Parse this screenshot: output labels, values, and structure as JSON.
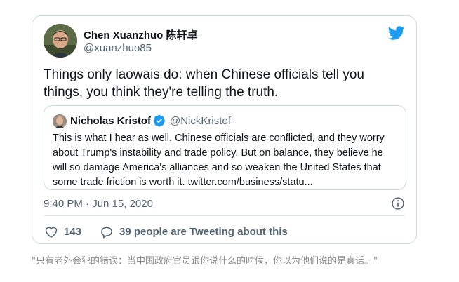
{
  "tweet": {
    "author_name": "Chen Xuanzhuo 陈轩卓",
    "author_handle": "@xuanzhuo85",
    "text": "Things only laowais do: when Chinese officials tell you things, you think they're telling the truth.",
    "timestamp": "9:40 PM · Jun 15, 2020",
    "likes": "143",
    "reply_text": "39 people are Tweeting about this"
  },
  "quoted_tweet": {
    "author_name": "Nicholas Kristof",
    "author_handle": "@NickKristof",
    "verified": true,
    "text": "This is what I hear as well. Chinese officials are conflicted, and they worry about Trump's instability and trade policy. But on balance, they believe he will so damage America's alliances and so weaken the United States that some trade friction is worth it. twitter.com/business/statu..."
  },
  "caption": "\"只有老外会犯的错误：当中国政府官员跟你说什么的时候，你以为他们说的是真话。\"",
  "colors": {
    "twitter_blue": "#1d9bf0",
    "text_primary": "#0f1419",
    "text_secondary": "#536471",
    "border": "#cfd9de"
  },
  "icons": [
    "twitter-bird-icon",
    "verified-badge-icon",
    "info-icon",
    "heart-icon",
    "reply-bubble-icon"
  ]
}
